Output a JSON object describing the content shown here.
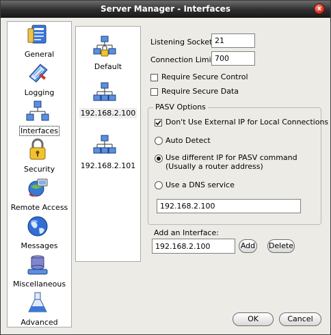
{
  "window": {
    "title": "Server Manager - Interfaces",
    "close_glyph": "x"
  },
  "nav": {
    "items": [
      {
        "label": "General",
        "icon": "general-icon"
      },
      {
        "label": "Logging",
        "icon": "logging-icon"
      },
      {
        "label": "Interfaces",
        "icon": "interfaces-icon",
        "selected": true
      },
      {
        "label": "Security",
        "icon": "lock-icon"
      },
      {
        "label": "Remote Access",
        "icon": "remote-access-icon"
      },
      {
        "label": "Messages",
        "icon": "globe-icon"
      },
      {
        "label": "Miscellaneous",
        "icon": "miscellaneous-icon"
      },
      {
        "label": "Advanced",
        "icon": "flask-icon"
      }
    ]
  },
  "hosts": [
    {
      "label": "Default",
      "icon": "network-locked-icon"
    },
    {
      "label": "192.168.2.100",
      "icon": "network-icon",
      "selected": true
    },
    {
      "label": "192.168.2.101",
      "icon": "network-icon"
    }
  ],
  "settings": {
    "listening_socket_label": "Listening Socket:",
    "listening_socket_value": "21",
    "connection_limit_label": "Connection Limit:",
    "connection_limit_value": "700",
    "require_secure_control_label": "Require Secure Control",
    "require_secure_control_checked": false,
    "require_secure_data_label": "Require Secure Data",
    "require_secure_data_checked": false
  },
  "pasv": {
    "title": "PASV Options",
    "dont_use_external_ip_label": "Don't Use External IP for Local Connections",
    "dont_use_external_ip_checked": true,
    "auto_detect_label": "Auto Detect",
    "use_different_ip_label_line1": "Use different IP for PASV command",
    "use_different_ip_label_line2": "(Usually a router address)",
    "use_dns_label": "Use a DNS service",
    "selected_option": "use_different_ip",
    "ip_value": "192.168.2.100"
  },
  "add_interface": {
    "label": "Add an Interface:",
    "value": "192.168.2.100",
    "add_label": "Add",
    "delete_label": "Delete"
  },
  "buttons": {
    "ok": "OK",
    "cancel": "Cancel"
  }
}
